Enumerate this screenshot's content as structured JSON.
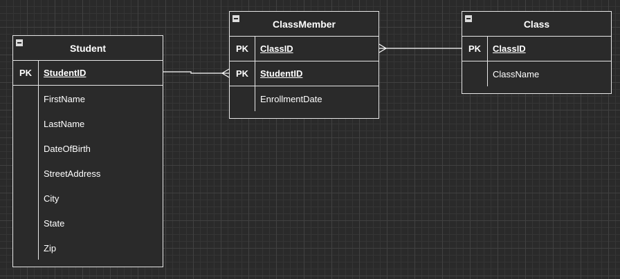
{
  "entities": {
    "student": {
      "title": "Student",
      "key_label": "PK",
      "primary_key": "StudentID",
      "fields": [
        "FirstName",
        "LastName",
        "DateOfBirth",
        "StreetAddress",
        "City",
        "State",
        "Zip"
      ]
    },
    "classmember": {
      "title": "ClassMember",
      "key_label_1": "PK",
      "primary_key_1": "ClassID",
      "key_label_2": "PK",
      "primary_key_2": "StudentID",
      "fields": [
        "EnrollmentDate"
      ]
    },
    "class": {
      "title": "Class",
      "key_label": "PK",
      "primary_key": "ClassID",
      "fields": [
        "ClassName"
      ]
    }
  },
  "colors": {
    "background": "#2a2a2a",
    "grid": "#414141",
    "lines": "#e8e8e8",
    "text": "#ffffff"
  },
  "icons": [
    "collapse-icon"
  ]
}
